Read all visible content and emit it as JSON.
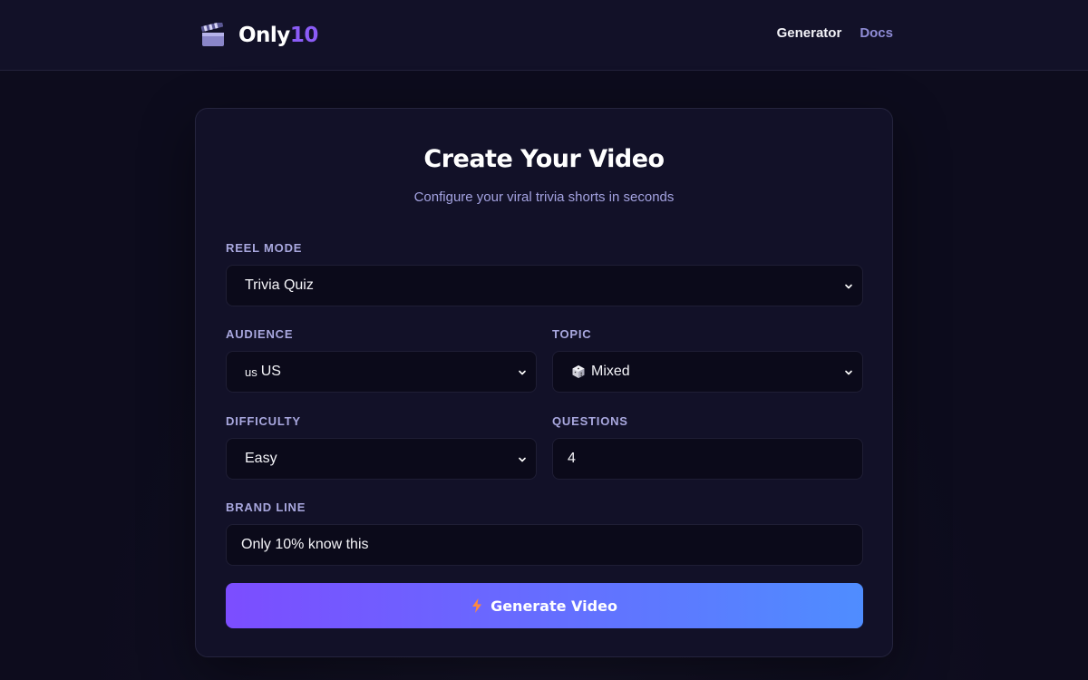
{
  "header": {
    "brand_main": "Only",
    "brand_accent": "10",
    "nav": [
      {
        "label": "Generator",
        "active": true
      },
      {
        "label": "Docs",
        "active": false
      }
    ]
  },
  "card": {
    "title": "Create Your Video",
    "subtitle": "Configure your viral trivia shorts in seconds"
  },
  "form": {
    "reel_mode": {
      "label": "REEL MODE",
      "value": "Trivia Quiz"
    },
    "audience": {
      "label": "AUDIENCE",
      "flag": "us",
      "value": "US"
    },
    "topic": {
      "label": "TOPIC",
      "icon": "dice-icon",
      "value": "Mixed"
    },
    "difficulty": {
      "label": "DIFFICULTY",
      "value": "Easy"
    },
    "questions": {
      "label": "QUESTIONS",
      "value": "4"
    },
    "brand_line": {
      "label": "BRAND LINE",
      "value": "Only 10% know this"
    }
  },
  "actions": {
    "generate_label": "Generate Video",
    "icon": "lightning-icon"
  },
  "colors": {
    "accent": "#8b5cf6",
    "button_start": "#7c4dff",
    "button_end": "#4f8dff",
    "background": "#0d0c1d",
    "card": "#121128"
  }
}
